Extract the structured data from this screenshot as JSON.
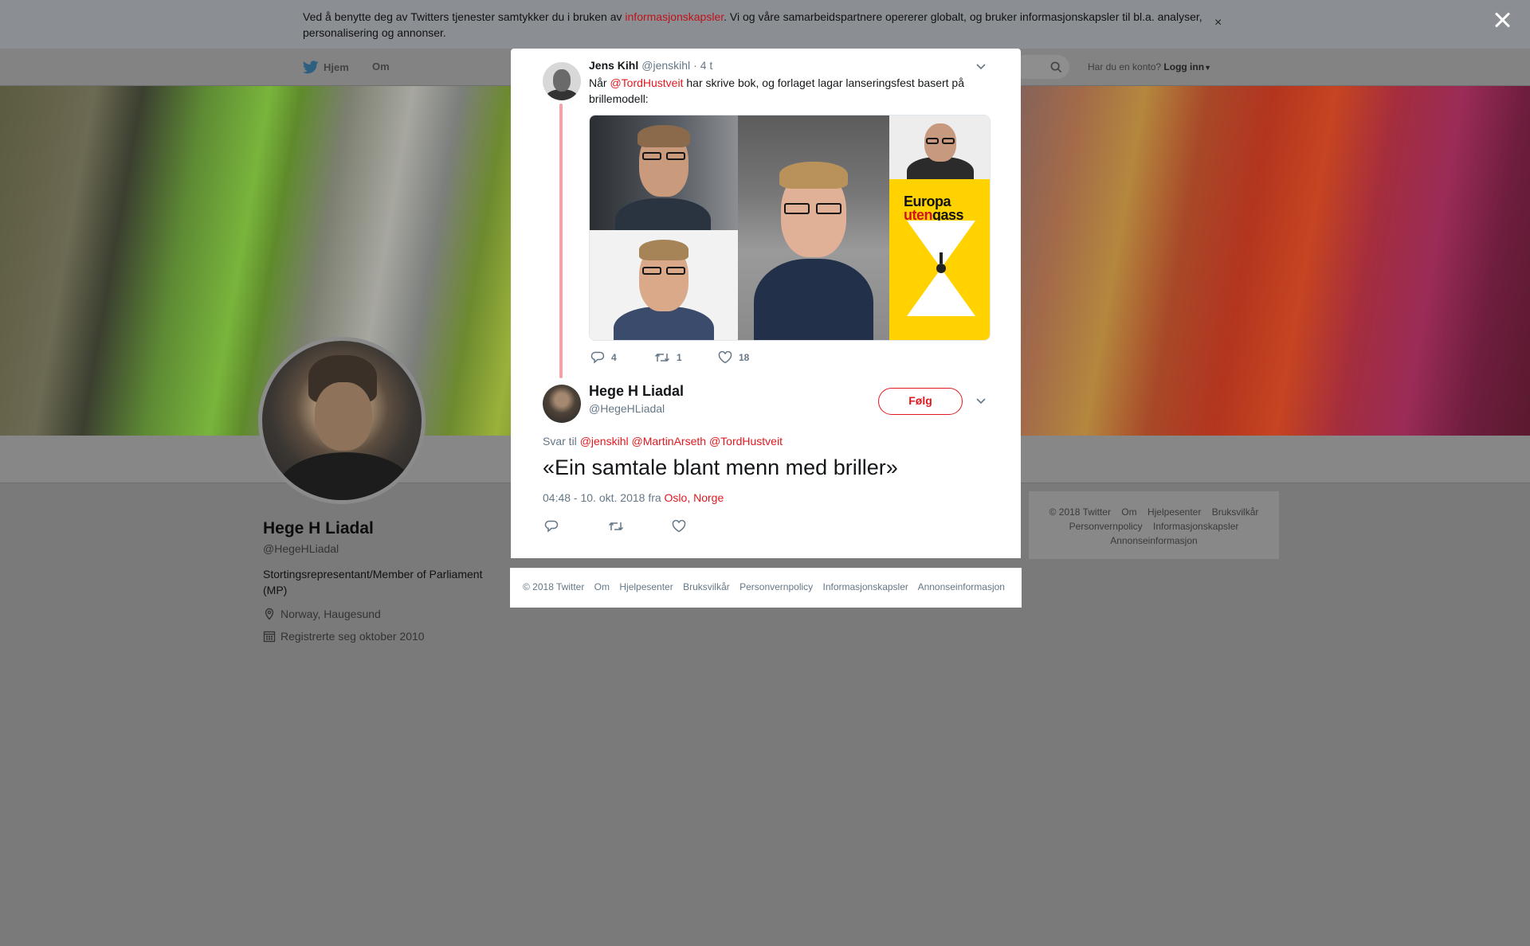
{
  "cookie_banner": {
    "text_before": "Ved å benytte deg av Twitters tjenester samtykker du i bruken av ",
    "link": "informasjonskapsler",
    "text_after": ". Vi og våre samarbeidspartnere opererer globalt, og bruker informasjonskapsler til bl.a. analyser, personalisering og annonser.",
    "close": "×"
  },
  "nav": {
    "home": "Hjem",
    "about": "Om",
    "login_prompt": "Har du en konto?",
    "login": "Logg inn"
  },
  "profile": {
    "name": "Hege H Liadal",
    "handle": "@HegeHLiadal",
    "bio": "Stortingsrepresentant/Member of Parliament (MP)",
    "location": "Norway, Haugesund",
    "joined": "Registrerte seg oktober 2010"
  },
  "side_footer": {
    "links": [
      "© 2018 Twitter",
      "Om",
      "Hjelpesenter",
      "Bruksvilkår",
      "Personvernpolicy",
      "Informasjonskapsler",
      "Annonseinformasjon"
    ]
  },
  "parent_tweet": {
    "name": "Jens Kihl",
    "handle": "@jenskihl",
    "time": "· 4 t",
    "text_before": "Når ",
    "mention": "@TordHustveit",
    "text_after": " har skrive bok, og forlaget lagar lanseringsfest basert på brillemodell:",
    "book_title_1": "Europa",
    "book_title_2a": "uten",
    "book_title_2b": "gass",
    "replies": "4",
    "retweets": "1",
    "likes": "18"
  },
  "main_tweet": {
    "name": "Hege H Liadal",
    "handle": "@HegeHLiadal",
    "follow": "Følg",
    "reply_prefix": "Svar til",
    "reply_mentions": [
      "@jenskihl",
      "@MartinArseth",
      "@TordHustveit"
    ],
    "text": "«Ein samtale blant menn med briller»",
    "timestamp": "04:48 - 10. okt. 2018 fra",
    "location": "Oslo, Norge"
  },
  "modal_footer": {
    "links": [
      "© 2018 Twitter",
      "Om",
      "Hjelpesenter",
      "Bruksvilkår",
      "Personvernpolicy",
      "Informasjonskapsler",
      "Annonseinformasjon"
    ]
  },
  "colors": {
    "accent": "#e0191f",
    "muted": "#657786",
    "overlay": "#7a7a7a"
  }
}
